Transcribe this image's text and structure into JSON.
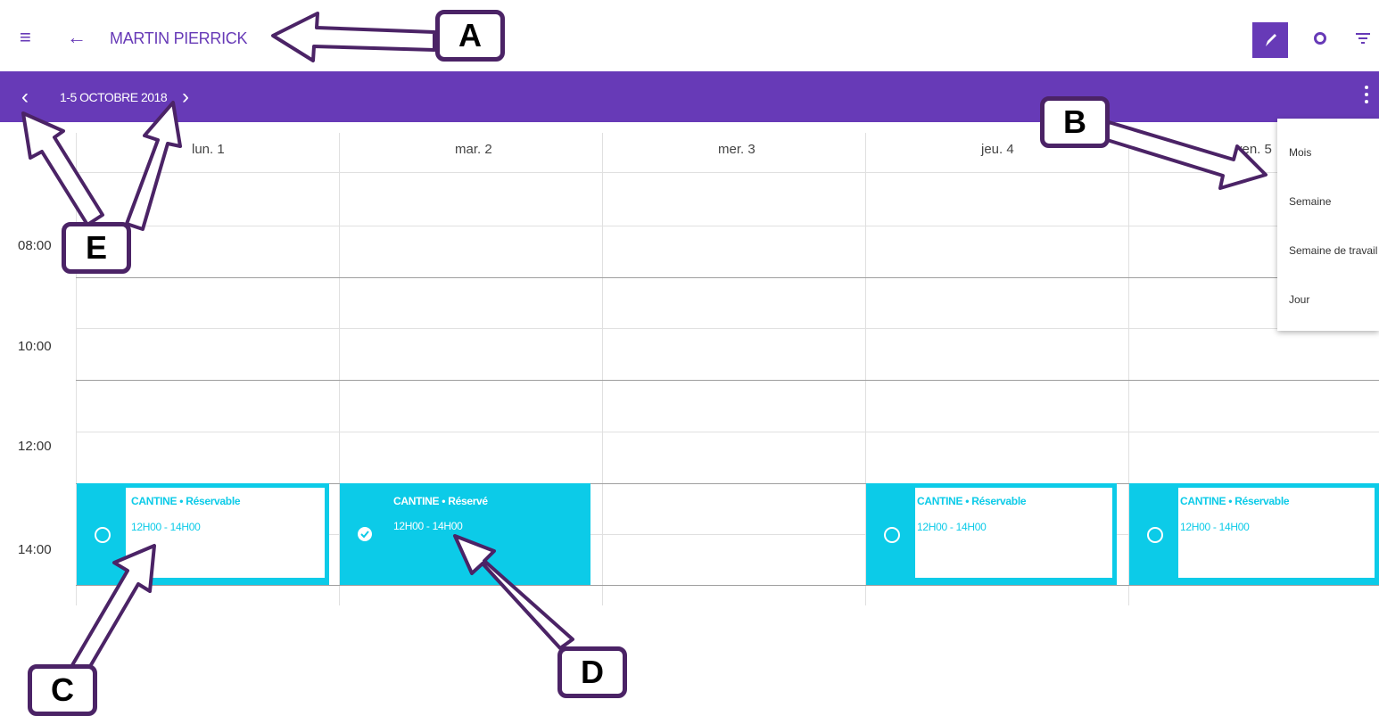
{
  "header": {
    "menu_icon": "hamburger-icon",
    "back_icon": "arrow-left-icon",
    "title": "MARTIN PIERRICK",
    "actions": [
      "edit-icon",
      "eye-icon",
      "filter-icon"
    ]
  },
  "navigation": {
    "prev_icon": "chevron-left-icon",
    "next_icon": "chevron-right-icon",
    "date_range": "1-5 OCTOBRE 2018",
    "more_icon": "more-vertical-icon"
  },
  "calendar": {
    "days": [
      "lun. 1",
      "mar. 2",
      "mer. 3",
      "jeu. 4",
      "ven. 5"
    ],
    "times": [
      "08:00",
      "10:00",
      "12:00",
      "14:00"
    ],
    "events": [
      {
        "title": "CANTINE • Réservable",
        "time": "12H00 - 14H00",
        "status": "reservable"
      },
      {
        "title": "CANTINE • Réservé",
        "time": "12H00 - 14H00",
        "status": "reserved"
      },
      {
        "title": "CANTINE • Réservable",
        "time": "12H00 - 14H00",
        "status": "reservable"
      },
      {
        "title": "CANTINE • Réservable",
        "time": "12H00 - 14H00",
        "status": "reservable"
      }
    ]
  },
  "view_menu": {
    "items": [
      "Mois",
      "Semaine",
      "Semaine de travail",
      "Jour"
    ]
  },
  "callouts": [
    "A",
    "B",
    "C",
    "D",
    "E"
  ],
  "colors": {
    "primary": "#673ab7",
    "event": "#0ccbe8",
    "callout_border": "#4b2366"
  }
}
